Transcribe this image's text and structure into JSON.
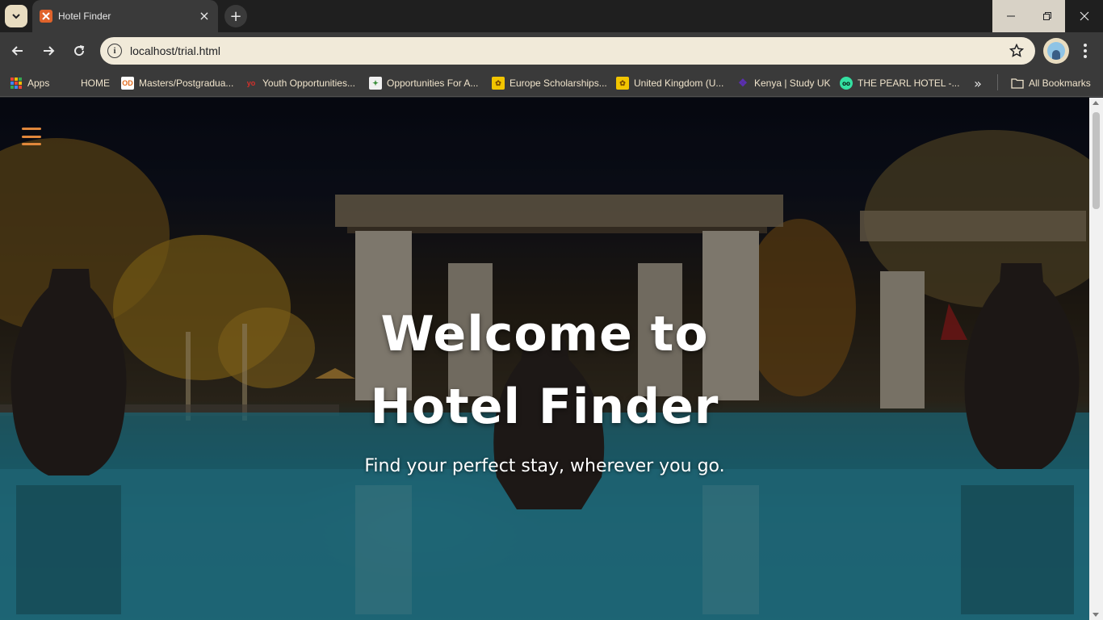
{
  "browser": {
    "tab": {
      "title": "Hotel Finder",
      "close": "×"
    },
    "new_tab": "+",
    "address": {
      "url": "localhost/trial.html"
    },
    "bookmarks": [
      {
        "label": "Apps",
        "icon": "apps-grid-icon"
      },
      {
        "label": "HOME",
        "icon": "globe-icon"
      },
      {
        "label": "Masters/Postgradua...",
        "icon": "od-logo-icon"
      },
      {
        "label": "Youth Opportunities...",
        "icon": "yo-logo-icon"
      },
      {
        "label": "Opportunities For A...",
        "icon": "ofa-logo-icon"
      },
      {
        "label": "Europe Scholarships...",
        "icon": "scholarship-icon"
      },
      {
        "label": "United Kingdom (U...",
        "icon": "scholarship-icon"
      },
      {
        "label": "Kenya | Study UK",
        "icon": "study-uk-icon"
      },
      {
        "label": "THE PEARL HOTEL -...",
        "icon": "tripadvisor-icon"
      }
    ],
    "more_bookmarks": "»",
    "all_bookmarks": "All Bookmarks"
  },
  "page": {
    "hero_title": "Welcome to Hotel Finder",
    "hero_subtitle": "Find your perfect stay, wherever you go.",
    "menu_icon": "hamburger-menu-icon"
  },
  "colors": {
    "accent": "#e0873b",
    "tab_bg": "#3a3a3a",
    "omnibox_bg": "#f1ead9",
    "bookmark_text": "#f0e4cc"
  }
}
